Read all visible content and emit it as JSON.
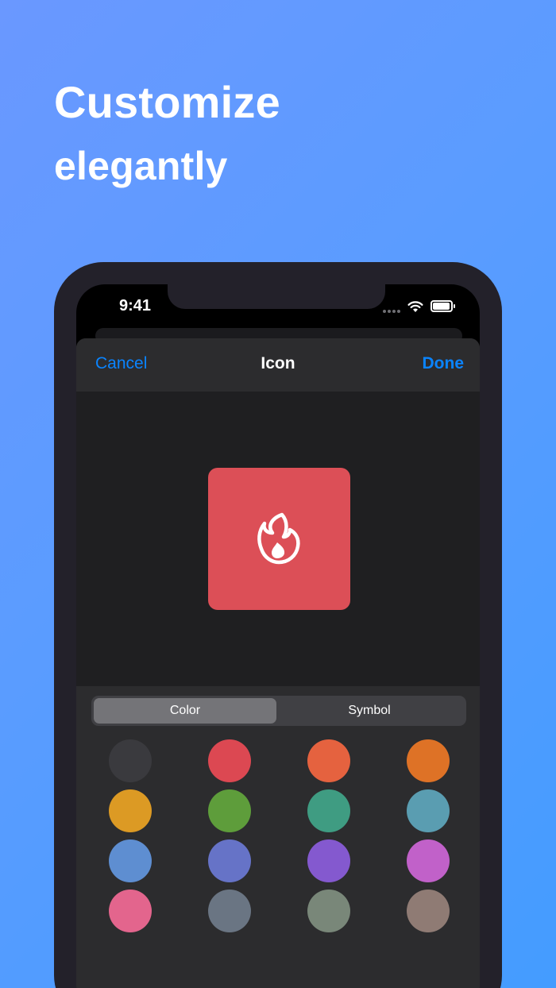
{
  "marketing": {
    "line1": "Customize",
    "line2": "elegantly"
  },
  "status_bar": {
    "time": "9:41"
  },
  "nav": {
    "cancel": "Cancel",
    "title": "Icon",
    "done": "Done"
  },
  "preview": {
    "icon": "flame-icon",
    "tile_color": "#dc4f57"
  },
  "segmented": {
    "options": [
      "Color",
      "Symbol"
    ],
    "selected": "Color"
  },
  "colors": {
    "accent": "#0a84ff",
    "swatches": [
      "#3a3a3e",
      "#dc4852",
      "#e5623f",
      "#de7226",
      "#dc9a24",
      "#5e9d3b",
      "#3f9c82",
      "#5a9db1",
      "#5e8ed1",
      "#6673c7",
      "#8459cf",
      "#c161c9",
      "#e3658d",
      "#6a7583",
      "#798779",
      "#8f7b74"
    ]
  }
}
